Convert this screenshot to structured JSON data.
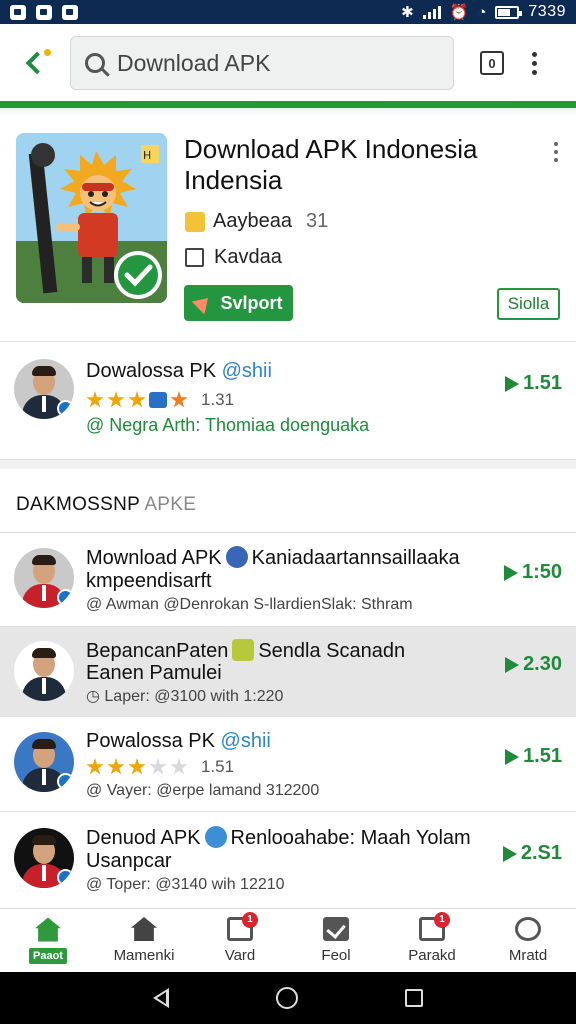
{
  "status_bar": {
    "time": "7339"
  },
  "search": {
    "placeholder": "Download APK"
  },
  "tab_count": "0",
  "featured": {
    "title": "Download APK Indonesia Indensia",
    "rating_label": "Aaybeaa",
    "rating_value": "31",
    "checkbox_label": "Kavdaa",
    "primary_button": "Svlport",
    "secondary_button": "Siolla"
  },
  "top_item": {
    "title": "Dowalossa PK",
    "handle": "@shii",
    "rating": "1.31",
    "subtitle": "@ Negra Arth: Thomiaa doenguaka",
    "price": "1.51",
    "stars": [
      "full",
      "full",
      "full",
      "blue",
      "alt"
    ]
  },
  "section": {
    "title": "DAKMOSSNP",
    "suffix": "APKE"
  },
  "items": [
    {
      "title": "Mownload APK",
      "title_extra": "Kaniadaartannsaillaaka",
      "title_line2": "kmpeendisarft",
      "subtitle": "@ Awman @Denrokan S-llardienSlak: Sthram",
      "price": "1:50"
    },
    {
      "title": "BepancanPaten",
      "title_extra": "Sendla Scanadn",
      "title_line2": "Eanen Pamulei",
      "subtitle": "Laper: @3100 with 1:220",
      "price": "2.30"
    },
    {
      "title": "Powalossa PK",
      "handle": "@shii",
      "rating": "1.51",
      "subtitle": "@ Vayer: @erpe lamand 312200",
      "price": "1.51",
      "stars": [
        "full",
        "full",
        "full",
        "off",
        "off"
      ]
    },
    {
      "title": "Denuod APK",
      "title_extra": "Renlooahabe: Maah Yolam",
      "title_line2": "Usanpcar",
      "subtitle": "@ Toper: @3140 wih 12210",
      "price": "2.S1"
    }
  ],
  "bottom_nav": [
    {
      "label": "Paaot",
      "icon": "home-icon",
      "badge": ""
    },
    {
      "label": "Mamenki",
      "icon": "home-icon",
      "badge": ""
    },
    {
      "label": "Vard",
      "icon": "card-icon",
      "badge": "1"
    },
    {
      "label": "Feol",
      "icon": "check-icon",
      "badge": ""
    },
    {
      "label": "Parakd",
      "icon": "card-icon",
      "badge": "1"
    },
    {
      "label": "Mratd",
      "icon": "search-icon",
      "badge": ""
    }
  ],
  "colors": {
    "accent": "#23963f",
    "status_bar": "#0d2a52",
    "link": "#2b86c5"
  }
}
